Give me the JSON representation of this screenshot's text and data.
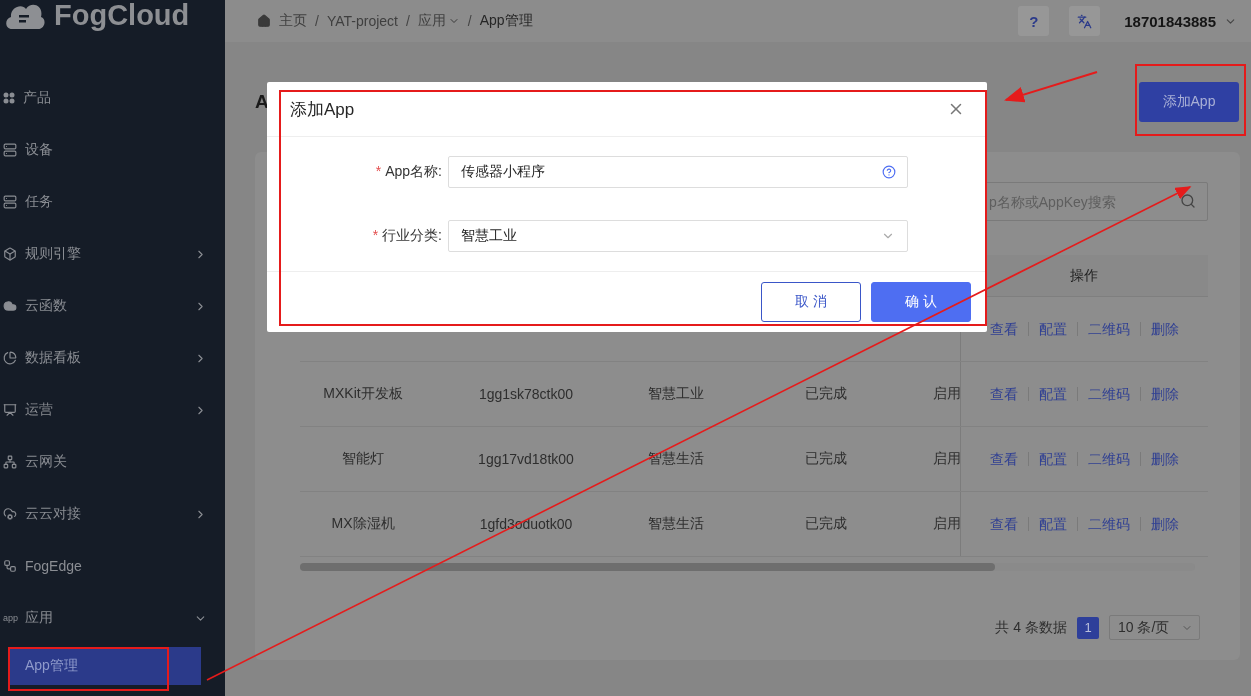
{
  "sidebar": {
    "logo": "FogCloud",
    "items": [
      {
        "label": "产品",
        "kind": "link"
      },
      {
        "label": "设备",
        "kind": "link"
      },
      {
        "label": "任务",
        "kind": "link"
      },
      {
        "label": "规则引擎",
        "kind": "submenu",
        "expanded": false
      },
      {
        "label": "云函数",
        "kind": "submenu",
        "expanded": false
      },
      {
        "label": "数据看板",
        "kind": "submenu",
        "expanded": false
      },
      {
        "label": "运营",
        "kind": "submenu",
        "expanded": false
      },
      {
        "label": "云网关",
        "kind": "link"
      },
      {
        "label": "云云对接",
        "kind": "submenu",
        "expanded": false
      },
      {
        "label": "FogEdge",
        "kind": "link"
      },
      {
        "label": "应用",
        "kind": "submenu",
        "expanded": true,
        "icon_text": "app",
        "children": [
          {
            "label": "App管理",
            "selected": true
          }
        ]
      }
    ]
  },
  "header": {
    "separator": "/",
    "breadcrumb": [
      {
        "label": "主页",
        "dropdown": false
      },
      {
        "label": "YAT-project",
        "dropdown": false
      },
      {
        "label": "应用",
        "dropdown": true
      },
      {
        "label": "App管理",
        "dropdown": false
      }
    ],
    "help": "?",
    "user": "18701843885"
  },
  "page": {
    "title": "A",
    "add_button": "添加App",
    "search": {
      "placeholder": "p名称或AppKey搜索"
    }
  },
  "table": {
    "columns": [
      {
        "label": "操作"
      }
    ],
    "rows": [
      {
        "actions": [
          "查看",
          "配置",
          "二维码",
          "删除"
        ]
      },
      {
        "cells": [
          "MXKit开发板",
          "1gg1sk78ctk00",
          "智慧工业",
          "已完成",
          "启用"
        ],
        "actions": [
          "查看",
          "配置",
          "二维码",
          "删除"
        ]
      },
      {
        "cells": [
          "智能灯",
          "1gg17vd18tk00",
          "智慧生活",
          "已完成",
          "启用"
        ],
        "actions": [
          "查看",
          "配置",
          "二维码",
          "删除"
        ]
      },
      {
        "cells": [
          "MX除湿机",
          "1gfd3oduotk00",
          "智慧生活",
          "已完成",
          "启用"
        ],
        "actions": [
          "查看",
          "配置",
          "二维码",
          "删除"
        ]
      }
    ]
  },
  "pagination": {
    "total": "共 4 条数据",
    "pages": [
      {
        "label": "1",
        "selected": true
      }
    ],
    "page_size": "10 条/页"
  },
  "dialog": {
    "title": "添加App",
    "required_mark": "*",
    "fields": [
      {
        "kind": "input",
        "label": "App名称:",
        "required": true,
        "value": "传感器小程序"
      },
      {
        "kind": "select",
        "label": "行业分类:",
        "required": true,
        "value": "智慧工业"
      }
    ],
    "buttons": [
      {
        "kind": "secondary",
        "label": "取 消"
      },
      {
        "kind": "primary",
        "label": "确 认"
      }
    ]
  }
}
